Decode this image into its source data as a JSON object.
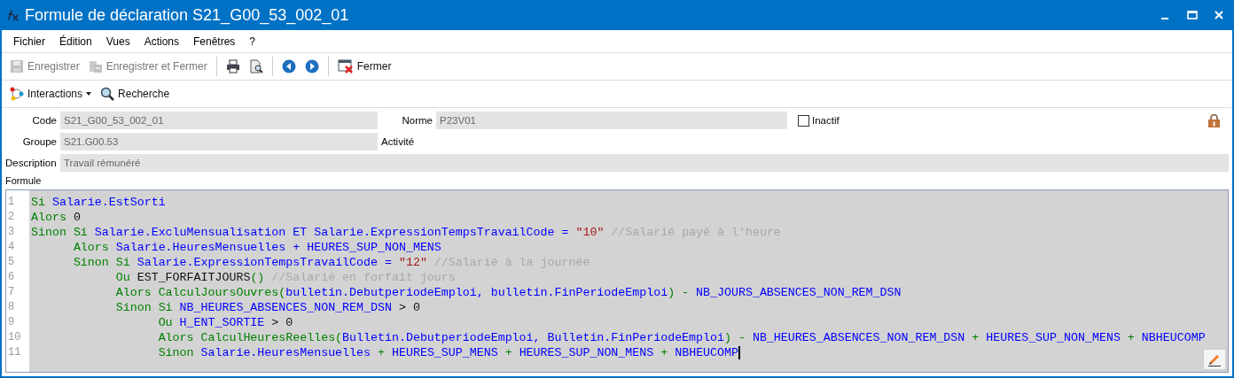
{
  "window": {
    "title": "Formule de déclaration S21_G00_53_002_01"
  },
  "menu": [
    "Fichier",
    "Édition",
    "Vues",
    "Actions",
    "Fenêtres",
    "?"
  ],
  "toolbar": [
    {
      "kind": "save",
      "label": "Enregistrer",
      "disabled": true
    },
    {
      "kind": "save-close",
      "label": "Enregistrer et Fermer",
      "disabled": true
    },
    {
      "kind": "separator"
    },
    {
      "kind": "print"
    },
    {
      "kind": "preview"
    },
    {
      "kind": "separator"
    },
    {
      "kind": "back"
    },
    {
      "kind": "forward"
    },
    {
      "kind": "separator"
    },
    {
      "kind": "close",
      "label": "Fermer",
      "disabled": false
    }
  ],
  "toolbar2": [
    {
      "kind": "interactions",
      "label": "Interactions"
    },
    {
      "kind": "search",
      "label": "Recherche"
    }
  ],
  "form": {
    "code": {
      "label": "Code",
      "value": "S21_G00_53_002_01"
    },
    "norme": {
      "label": "Norme",
      "value": "P23V01"
    },
    "inactif": {
      "label": "Inactif",
      "checked": false
    },
    "groupe": {
      "label": "Groupe",
      "value": "S21.G00.53"
    },
    "activite": {
      "label": "Activité"
    },
    "description": {
      "label": "Description",
      "value": "Travail rémunéré"
    },
    "formule": {
      "label": "Formule"
    }
  },
  "editor": {
    "lines": [
      {
        "number": "1",
        "tokens": [
          {
            "kind": "kw",
            "text": "Si "
          },
          {
            "kind": "id",
            "text": "Salarie.EstSorti"
          }
        ]
      },
      {
        "number": "2",
        "tokens": [
          {
            "kind": "kw",
            "text": "Alors "
          },
          {
            "kind": "num",
            "text": "0"
          }
        ]
      },
      {
        "number": "3",
        "tokens": [
          {
            "kind": "kw",
            "text": "Sinon Si "
          },
          {
            "kind": "id",
            "text": "Salarie.ExcluMensualisation ET Salarie.ExpressionTempsTravailCode = "
          },
          {
            "kind": "str",
            "text": "\"10\""
          },
          {
            "kind": "cmt",
            "text": " //Salarié payé à l'heure"
          }
        ]
      },
      {
        "number": "4",
        "tokens": [
          {
            "kind": "kw",
            "text": "      Alors "
          },
          {
            "kind": "id",
            "text": "Salarie.HeuresMensuelles + HEURES_SUP_NON_MENS"
          }
        ]
      },
      {
        "number": "5",
        "tokens": [
          {
            "kind": "kw",
            "text": "      Sinon Si "
          },
          {
            "kind": "id",
            "text": "Salarie.ExpressionTempsTravailCode = "
          },
          {
            "kind": "str",
            "text": "\"12\""
          },
          {
            "kind": "cmt",
            "text": " //Salarié à la journée"
          }
        ]
      },
      {
        "number": "6",
        "tokens": [
          {
            "kind": "kw",
            "text": "            Ou "
          },
          {
            "kind": "num",
            "text": "EST_FORFAITJOURS"
          },
          {
            "kind": "kw",
            "text": "()"
          },
          {
            "kind": "cmt",
            "text": " //Salarié en forfait jours"
          }
        ]
      },
      {
        "number": "7",
        "tokens": [
          {
            "kind": "kw",
            "text": "            Alors CalculJoursOuvres("
          },
          {
            "kind": "id",
            "text": "bulletin.DebutperiodeEmploi, bulletin.FinPeriodeEmploi"
          },
          {
            "kind": "kw",
            "text": ") - "
          },
          {
            "kind": "id",
            "text": "NB_JOURS_ABSENCES_NON_REM_DSN"
          }
        ]
      },
      {
        "number": "8",
        "tokens": [
          {
            "kind": "kw",
            "text": "            Sinon Si "
          },
          {
            "kind": "id",
            "text": "NB_HEURES_ABSENCES_NON_REM_DSN "
          },
          {
            "kind": "num",
            "text": "> 0"
          }
        ]
      },
      {
        "number": "9",
        "tokens": [
          {
            "kind": "kw",
            "text": "                  Ou "
          },
          {
            "kind": "id",
            "text": "H_ENT_SORTIE "
          },
          {
            "kind": "num",
            "text": "> 0"
          }
        ]
      },
      {
        "number": "10",
        "tokens": [
          {
            "kind": "kw",
            "text": "                  Alors CalculHeuresReelles("
          },
          {
            "kind": "id",
            "text": "Bulletin.DebutperiodeEmploi, Bulletin.FinPeriodeEmploi"
          },
          {
            "kind": "kw",
            "text": ") - "
          },
          {
            "kind": "id",
            "text": "NB_HEURES_ABSENCES_NON_REM_DSN "
          },
          {
            "kind": "kw",
            "text": "+ "
          },
          {
            "kind": "id",
            "text": "HEURES_SUP_NON_MENS "
          },
          {
            "kind": "kw",
            "text": "+ "
          },
          {
            "kind": "id",
            "text": "NBHEUCOMP"
          }
        ]
      },
      {
        "number": "11",
        "tokens": [
          {
            "kind": "kw",
            "text": "                  Sinon "
          },
          {
            "kind": "id",
            "text": "Salarie.HeuresMensuelles "
          },
          {
            "kind": "kw",
            "text": "+ "
          },
          {
            "kind": "id",
            "text": "HEURES_SUP_MENS "
          },
          {
            "kind": "kw",
            "text": "+ "
          },
          {
            "kind": "id",
            "text": "HEURES_SUP_NON_MENS "
          },
          {
            "kind": "kw",
            "text": "+ "
          },
          {
            "kind": "id",
            "text": "NBHEUCOMP"
          }
        ]
      }
    ]
  }
}
